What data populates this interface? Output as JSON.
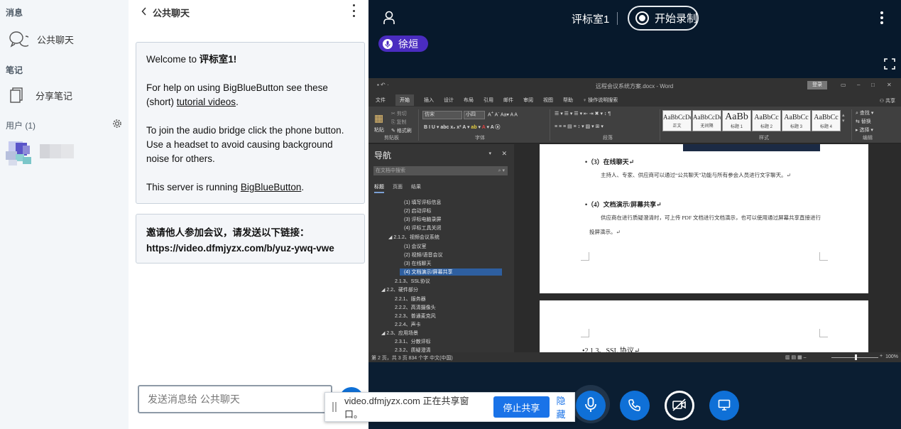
{
  "userlist": {
    "messages_title": "消息",
    "public_chat_label": "公共聊天",
    "notes_title": "笔记",
    "shared_notes_label": "分享笔记",
    "users_title": "用户 (1)"
  },
  "chat": {
    "header_title": "公共聊天",
    "welcome": {
      "prefix": "Welcome to ",
      "room": "评标室1",
      "suffix": "!",
      "help_text": "For help on using BigBlueButton see these (short) ",
      "tutorial_link": "tutorial videos",
      "help_end": ".",
      "audio_text": "To join the audio bridge click the phone button. Use a headset to avoid causing background noise for others.",
      "server_text": "This server is running ",
      "server_link": "BigBlueButton",
      "server_end": "."
    },
    "invite": {
      "line1": "邀请他人参加会议，请发送以下链接：",
      "url": "https://video.dfmjyzx.com/b/yuz-ywq-vwe"
    },
    "input_placeholder": "发送消息给 公共聊天"
  },
  "stage": {
    "room_name": "评标室1",
    "record_label": "开始录制",
    "talker_name": "徐烜"
  },
  "word": {
    "title": "远程会议系统方案.docx - Word",
    "login": "登录",
    "menu": [
      "文件",
      "开始",
      "插入",
      "设计",
      "布局",
      "引用",
      "邮件",
      "审阅",
      "视图",
      "帮助",
      "操作说明搜索"
    ],
    "share": "共享",
    "paste": "粘贴",
    "cut": "剪切",
    "copy": "复制",
    "format_painter": "格式刷",
    "clipboard": "剪贴板",
    "font_name": "仿宋",
    "font_size": "小四",
    "font_group": "字体",
    "para_group": "段落",
    "styles_group": "样式",
    "edit_group": "编辑",
    "find": "查找",
    "replace": "替换",
    "select": "选择",
    "styles": [
      {
        "sample": "AaBbCcDc",
        "name": "正文"
      },
      {
        "sample": "AaBbCcDc",
        "name": "无间隔"
      },
      {
        "sample": "AaBb",
        "name": "标题 1"
      },
      {
        "sample": "AaBbCc",
        "name": "标题 2"
      },
      {
        "sample": "AaBbCc",
        "name": "标题 3"
      },
      {
        "sample": "AaBbCc",
        "name": "标题 4"
      }
    ],
    "nav_title": "导航",
    "nav_search": "在文档中搜索",
    "nav_tabs": [
      "标题",
      "页面",
      "结果"
    ],
    "nav_items": [
      "(1) 填写评标信息",
      "(2) 启动评标",
      "(3) 评标电脑录屏",
      "(4) 评标工具关闭",
      "◢ 2.1.2、视频会议系统",
      "(1) 会议室",
      "(2) 视频/语音会议",
      "(3) 在线聊天",
      "(4) 文档演示/屏幕共享",
      "2.1.3、SSL协议",
      "◢ 2.2、硬件部分",
      "2.2.1、服务器",
      "2.2.2、高清摄像头",
      "2.2.3、普通麦克风",
      "2.2.4、声卡",
      "◢ 2.3、应用场景",
      "2.3.1、分散评标",
      "2.3.2、质疑澄清"
    ],
    "page1": {
      "h1": "•（3）在线聊天↵",
      "p1": "主持人、专家、供应商可以通过“公共聊天”功能与所有参会人员进行文字聊天。↵",
      "h2": "•（4）文档演示/屏幕共享↵",
      "p2": "供应商在进行质疑澄清时，可上传 PDF 文档进行文档演示，也可以使用通过屏幕共享直接进行投屏演示。↵"
    },
    "page2_heading": "•2.1.3、SSL 协议↵",
    "status_left": "第 2 页，共 3 页    834 个字    中文(中国)",
    "zoom": "100%"
  },
  "share_bar": {
    "text": "video.dfmjyzx.com 正在共享窗口。",
    "stop_label": "停止共享",
    "hide_label": "隐藏"
  },
  "colors": {
    "primary": "#0f70d7",
    "stage_bg": "#0b1e32",
    "talker_badge": "#4a2cc0"
  }
}
